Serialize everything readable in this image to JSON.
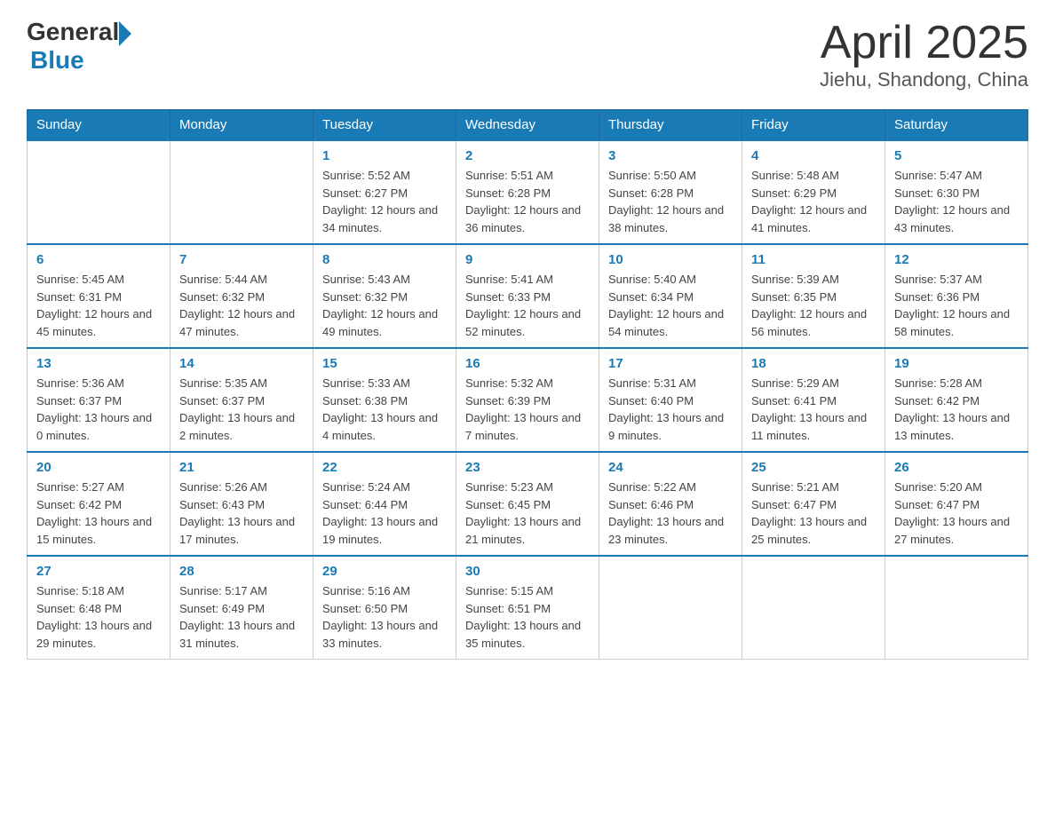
{
  "logo": {
    "text_general": "General",
    "text_blue": "Blue"
  },
  "title": "April 2025",
  "subtitle": "Jiehu, Shandong, China",
  "header_color": "#1a7ab5",
  "days_of_week": [
    "Sunday",
    "Monday",
    "Tuesday",
    "Wednesday",
    "Thursday",
    "Friday",
    "Saturday"
  ],
  "weeks": [
    [
      {
        "day": "",
        "sunrise": "",
        "sunset": "",
        "daylight": ""
      },
      {
        "day": "",
        "sunrise": "",
        "sunset": "",
        "daylight": ""
      },
      {
        "day": "1",
        "sunrise": "5:52 AM",
        "sunset": "6:27 PM",
        "daylight": "12 hours and 34 minutes."
      },
      {
        "day": "2",
        "sunrise": "5:51 AM",
        "sunset": "6:28 PM",
        "daylight": "12 hours and 36 minutes."
      },
      {
        "day": "3",
        "sunrise": "5:50 AM",
        "sunset": "6:28 PM",
        "daylight": "12 hours and 38 minutes."
      },
      {
        "day": "4",
        "sunrise": "5:48 AM",
        "sunset": "6:29 PM",
        "daylight": "12 hours and 41 minutes."
      },
      {
        "day": "5",
        "sunrise": "5:47 AM",
        "sunset": "6:30 PM",
        "daylight": "12 hours and 43 minutes."
      }
    ],
    [
      {
        "day": "6",
        "sunrise": "5:45 AM",
        "sunset": "6:31 PM",
        "daylight": "12 hours and 45 minutes."
      },
      {
        "day": "7",
        "sunrise": "5:44 AM",
        "sunset": "6:32 PM",
        "daylight": "12 hours and 47 minutes."
      },
      {
        "day": "8",
        "sunrise": "5:43 AM",
        "sunset": "6:32 PM",
        "daylight": "12 hours and 49 minutes."
      },
      {
        "day": "9",
        "sunrise": "5:41 AM",
        "sunset": "6:33 PM",
        "daylight": "12 hours and 52 minutes."
      },
      {
        "day": "10",
        "sunrise": "5:40 AM",
        "sunset": "6:34 PM",
        "daylight": "12 hours and 54 minutes."
      },
      {
        "day": "11",
        "sunrise": "5:39 AM",
        "sunset": "6:35 PM",
        "daylight": "12 hours and 56 minutes."
      },
      {
        "day": "12",
        "sunrise": "5:37 AM",
        "sunset": "6:36 PM",
        "daylight": "12 hours and 58 minutes."
      }
    ],
    [
      {
        "day": "13",
        "sunrise": "5:36 AM",
        "sunset": "6:37 PM",
        "daylight": "13 hours and 0 minutes."
      },
      {
        "day": "14",
        "sunrise": "5:35 AM",
        "sunset": "6:37 PM",
        "daylight": "13 hours and 2 minutes."
      },
      {
        "day": "15",
        "sunrise": "5:33 AM",
        "sunset": "6:38 PM",
        "daylight": "13 hours and 4 minutes."
      },
      {
        "day": "16",
        "sunrise": "5:32 AM",
        "sunset": "6:39 PM",
        "daylight": "13 hours and 7 minutes."
      },
      {
        "day": "17",
        "sunrise": "5:31 AM",
        "sunset": "6:40 PM",
        "daylight": "13 hours and 9 minutes."
      },
      {
        "day": "18",
        "sunrise": "5:29 AM",
        "sunset": "6:41 PM",
        "daylight": "13 hours and 11 minutes."
      },
      {
        "day": "19",
        "sunrise": "5:28 AM",
        "sunset": "6:42 PM",
        "daylight": "13 hours and 13 minutes."
      }
    ],
    [
      {
        "day": "20",
        "sunrise": "5:27 AM",
        "sunset": "6:42 PM",
        "daylight": "13 hours and 15 minutes."
      },
      {
        "day": "21",
        "sunrise": "5:26 AM",
        "sunset": "6:43 PM",
        "daylight": "13 hours and 17 minutes."
      },
      {
        "day": "22",
        "sunrise": "5:24 AM",
        "sunset": "6:44 PM",
        "daylight": "13 hours and 19 minutes."
      },
      {
        "day": "23",
        "sunrise": "5:23 AM",
        "sunset": "6:45 PM",
        "daylight": "13 hours and 21 minutes."
      },
      {
        "day": "24",
        "sunrise": "5:22 AM",
        "sunset": "6:46 PM",
        "daylight": "13 hours and 23 minutes."
      },
      {
        "day": "25",
        "sunrise": "5:21 AM",
        "sunset": "6:47 PM",
        "daylight": "13 hours and 25 minutes."
      },
      {
        "day": "26",
        "sunrise": "5:20 AM",
        "sunset": "6:47 PM",
        "daylight": "13 hours and 27 minutes."
      }
    ],
    [
      {
        "day": "27",
        "sunrise": "5:18 AM",
        "sunset": "6:48 PM",
        "daylight": "13 hours and 29 minutes."
      },
      {
        "day": "28",
        "sunrise": "5:17 AM",
        "sunset": "6:49 PM",
        "daylight": "13 hours and 31 minutes."
      },
      {
        "day": "29",
        "sunrise": "5:16 AM",
        "sunset": "6:50 PM",
        "daylight": "13 hours and 33 minutes."
      },
      {
        "day": "30",
        "sunrise": "5:15 AM",
        "sunset": "6:51 PM",
        "daylight": "13 hours and 35 minutes."
      },
      {
        "day": "",
        "sunrise": "",
        "sunset": "",
        "daylight": ""
      },
      {
        "day": "",
        "sunrise": "",
        "sunset": "",
        "daylight": ""
      },
      {
        "day": "",
        "sunrise": "",
        "sunset": "",
        "daylight": ""
      }
    ]
  ]
}
